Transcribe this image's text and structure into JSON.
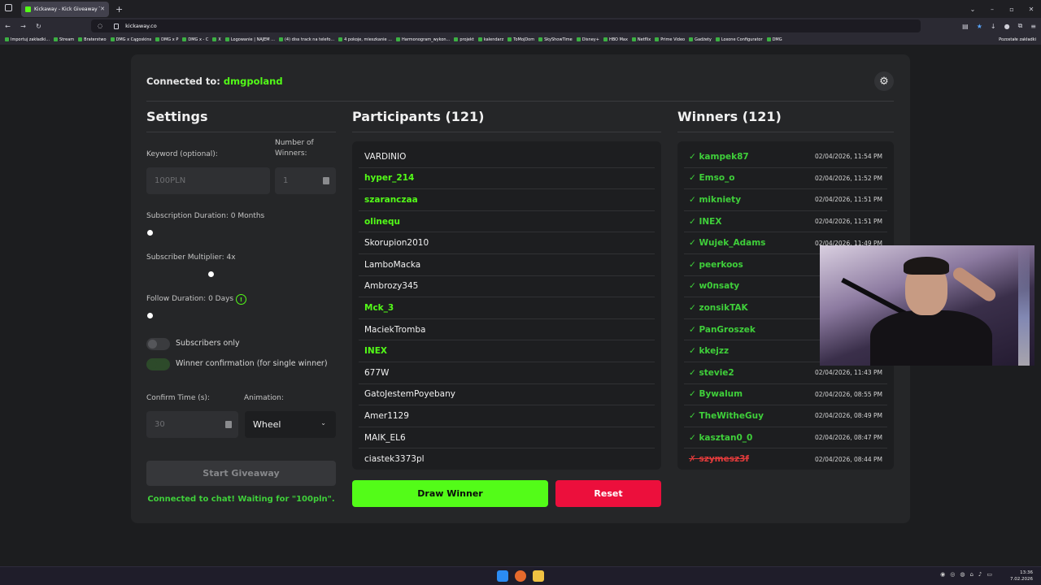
{
  "browser": {
    "tab_title": "Kickaway - Kick Giveaway Tool",
    "url": "kickaway.co",
    "bookmarks": [
      "Importuj zakładki...",
      "Stream",
      "Braterstwo",
      "DMG x Cągoskins",
      "DMG x P",
      "DMG x - C",
      "X",
      "Logowanie | NAJEM ...",
      "(4) diss track na telefo...",
      "4 pokoje, mieszkanie ...",
      "Harmonogram_wykon...",
      "projekt",
      "kalendarz",
      "ToMojDom",
      "SkyShowTime",
      "Disney+",
      "HBO Max",
      "Netflix",
      "Prime Video",
      "Gadżety",
      "Loxone Configurator",
      "DMG"
    ],
    "bookmarks_other": "Pozostałe zakładki"
  },
  "header": {
    "connected_prefix": "Connected to:",
    "channel": "dmgpoland"
  },
  "settings": {
    "title": "Settings",
    "keyword_label": "Keyword (optional):",
    "keyword_placeholder": "100PLN",
    "winners_label": "Number of Winners:",
    "winners_value": "1",
    "subscription_label": "Subscription Duration: 0 Months",
    "multiplier_label": "Subscriber Multiplier: 4x",
    "follow_label": "Follow Duration: 0 Days",
    "info_glyph": "!",
    "subs_only_label": "Subscribers only",
    "winner_confirm_label": "Winner confirmation (for single winner)",
    "confirm_time_label": "Confirm Time (s):",
    "confirm_time_value": "30",
    "animation_label": "Animation:",
    "animation_value": "Wheel",
    "start_button": "Start Giveaway",
    "status": "Connected to chat! Waiting for \"100pln\"."
  },
  "participants": {
    "title": "Participants (121)",
    "items": [
      {
        "name": "VARDINIO",
        "highlight": false
      },
      {
        "name": "hyper_214",
        "highlight": true
      },
      {
        "name": "szaranczaa",
        "highlight": true
      },
      {
        "name": "olinequ",
        "highlight": true
      },
      {
        "name": "Skorupion2010",
        "highlight": false
      },
      {
        "name": "LamboMacka",
        "highlight": false
      },
      {
        "name": "Ambrozy345",
        "highlight": false
      },
      {
        "name": "Mck_3",
        "highlight": true
      },
      {
        "name": "MaciekTromba",
        "highlight": false
      },
      {
        "name": "INEX",
        "highlight": true
      },
      {
        "name": "677W",
        "highlight": false
      },
      {
        "name": "GatoJestemPoyebany",
        "highlight": false
      },
      {
        "name": "Amer1129",
        "highlight": false
      },
      {
        "name": "MAIK_EL6",
        "highlight": false
      },
      {
        "name": "ciastek3373pl",
        "highlight": false
      }
    ]
  },
  "winners": {
    "title": "Winners (121)",
    "items": [
      {
        "name": "✓ kampek87",
        "time": "02/04/2026, 11:54 PM",
        "valid": true
      },
      {
        "name": "✓ Emso_o",
        "time": "02/04/2026, 11:52 PM",
        "valid": true
      },
      {
        "name": "✓ mikniety",
        "time": "02/04/2026, 11:51 PM",
        "valid": true
      },
      {
        "name": "✓ INEX",
        "time": "02/04/2026, 11:51 PM",
        "valid": true
      },
      {
        "name": "✓ Wujek_Adams",
        "time": "02/04/2026, 11:49 PM",
        "valid": true
      },
      {
        "name": "✓ peerkoos",
        "time": "",
        "valid": true
      },
      {
        "name": "✓ w0nsaty",
        "time": "",
        "valid": true
      },
      {
        "name": "✓ zonsikTAK",
        "time": "",
        "valid": true
      },
      {
        "name": "✓ PanGroszek",
        "time": "",
        "valid": true
      },
      {
        "name": "✓ kkejzz",
        "time": "",
        "valid": true
      },
      {
        "name": "✓ stevie2",
        "time": "02/04/2026, 11:43 PM",
        "valid": true
      },
      {
        "name": "✓ Bywalum",
        "time": "02/04/2026, 08:55 PM",
        "valid": true
      },
      {
        "name": "✓ TheWitheGuy",
        "time": "02/04/2026, 08:49 PM",
        "valid": true
      },
      {
        "name": "✓ kasztan0_0",
        "time": "02/04/2026, 08:47 PM",
        "valid": true
      },
      {
        "name": "✗ szymesz3f",
        "time": "02/04/2026, 08:44 PM",
        "valid": false
      }
    ]
  },
  "actions": {
    "draw": "Draw Winner",
    "reset": "Reset"
  },
  "taskbar": {
    "time": "13:36",
    "date": "7.02.2026"
  }
}
